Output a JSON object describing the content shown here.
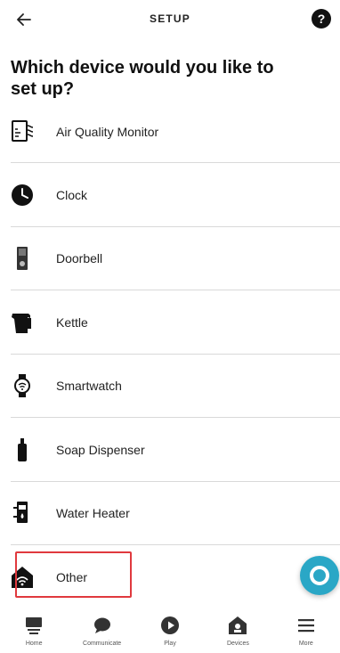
{
  "header": {
    "title": "SETUP",
    "help_label": "?"
  },
  "question": "Which device would you like to set up?",
  "devices": [
    {
      "label": "Air Quality Monitor",
      "icon": "air-quality-monitor-icon"
    },
    {
      "label": "Clock",
      "icon": "clock-icon"
    },
    {
      "label": "Doorbell",
      "icon": "doorbell-icon"
    },
    {
      "label": "Kettle",
      "icon": "kettle-icon"
    },
    {
      "label": "Smartwatch",
      "icon": "smartwatch-icon"
    },
    {
      "label": "Soap Dispenser",
      "icon": "soap-dispenser-icon"
    },
    {
      "label": "Water Heater",
      "icon": "water-heater-icon"
    },
    {
      "label": "Other",
      "icon": "other-device-icon"
    }
  ],
  "tabs": [
    {
      "label": "Home",
      "icon": "home-icon"
    },
    {
      "label": "Communicate",
      "icon": "communicate-icon"
    },
    {
      "label": "Play",
      "icon": "play-icon"
    },
    {
      "label": "Devices",
      "icon": "devices-icon"
    },
    {
      "label": "More",
      "icon": "more-icon"
    }
  ],
  "colors": {
    "highlight": "#e0393e",
    "fab": "#2aa7c6"
  }
}
